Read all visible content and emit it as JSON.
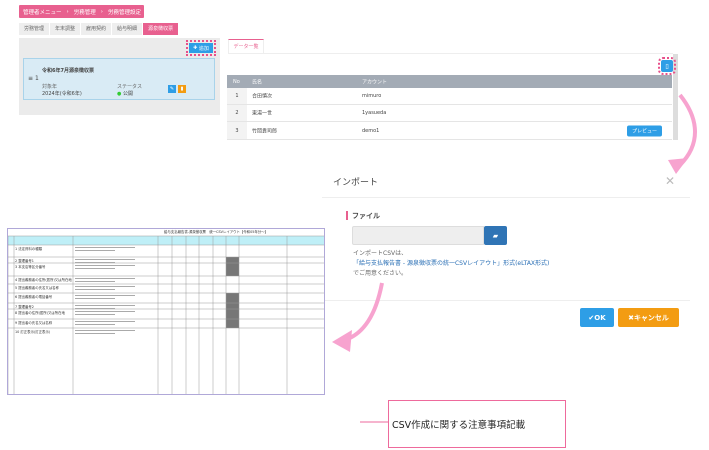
{
  "breadcrumb": [
    "管理者メニュー",
    "労務管理",
    "労務管理設定"
  ],
  "tabs": [
    "労務管理",
    "年末調整",
    "雇用契約",
    "給与明細",
    "源泉徴収票"
  ],
  "add_label": "追加",
  "card": {
    "title": "令和6年7月源泉徴収票",
    "number": "1",
    "target_label": "対象年",
    "target_value": "2024年(令和6年)",
    "status_label": "ステータス",
    "status_value": "公開"
  },
  "right": {
    "tab": "データ一覧",
    "columns": [
      "No",
      "氏名",
      "アカウント"
    ],
    "rows": [
      {
        "no": "1",
        "name": "合田慎次",
        "account": "mimuro"
      },
      {
        "no": "2",
        "name": "東湯一世",
        "account": "1yasueda"
      },
      {
        "no": "3",
        "name": "竹岡貴司郎",
        "account": "demo1",
        "action": "プレビュー"
      }
    ]
  },
  "modal": {
    "title": "インポート",
    "file_label": "ファイル",
    "note1": "インポートCSVは、",
    "note_link": "「給与支払報告書 - 源泉徴収票の統一CSVレイアウト」形式(eLTAX形式)",
    "note2": "でご用意ください。",
    "ok": "OK",
    "cancel": "キャンセル"
  },
  "sheet": {
    "title": "給与支払報告書-源泉徴収票　統一CSVレイアウト【令和05年分〜】",
    "items": [
      "法定資料の種類",
      "整理番号1",
      "本支店等区分番号",
      "提出義務者の住所(居所)又は所在地",
      "提出義務者の氏名又は名称",
      "提出義務者の電話番号",
      "整理番号2",
      "提出者の住所(居所)又は所在地",
      "提出者の氏名又は名称",
      "訂正表示(訂正表示)"
    ]
  },
  "callout": "CSV作成に関する注意事項記載",
  "colors": {
    "pink": "#e8608f",
    "blue": "#2e9ee6",
    "orange": "#f39c12"
  }
}
